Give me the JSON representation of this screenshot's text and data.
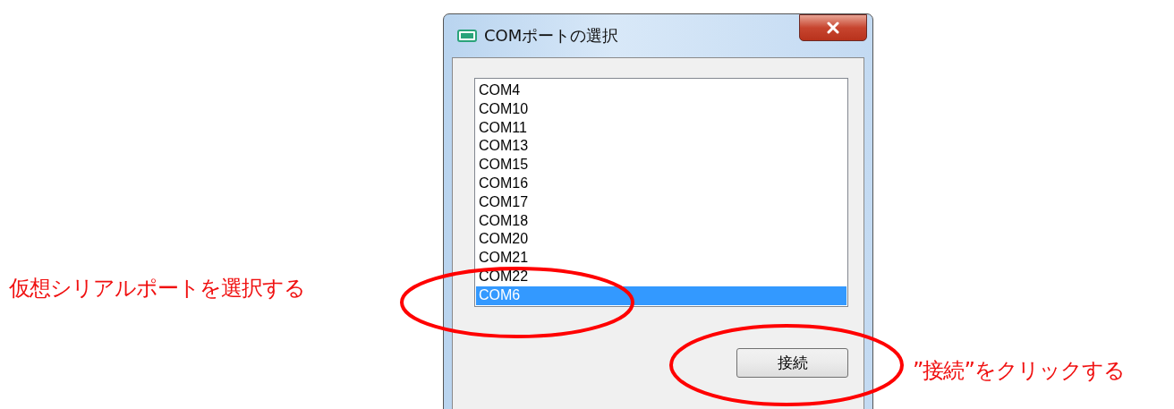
{
  "window": {
    "title": "COMポートの選択"
  },
  "ports": [
    {
      "label": "COM4",
      "selected": false
    },
    {
      "label": "COM10",
      "selected": false
    },
    {
      "label": "COM11",
      "selected": false
    },
    {
      "label": "COM13",
      "selected": false
    },
    {
      "label": "COM15",
      "selected": false
    },
    {
      "label": "COM16",
      "selected": false
    },
    {
      "label": "COM17",
      "selected": false
    },
    {
      "label": "COM18",
      "selected": false
    },
    {
      "label": "COM20",
      "selected": false
    },
    {
      "label": "COM21",
      "selected": false
    },
    {
      "label": "COM22",
      "selected": false
    },
    {
      "label": "COM6",
      "selected": true
    }
  ],
  "connect_button": {
    "label": "接続"
  },
  "annotations": [
    {
      "text": "仮想シリアルポートを選択する"
    },
    {
      "text": "”接続”をクリックする"
    }
  ]
}
